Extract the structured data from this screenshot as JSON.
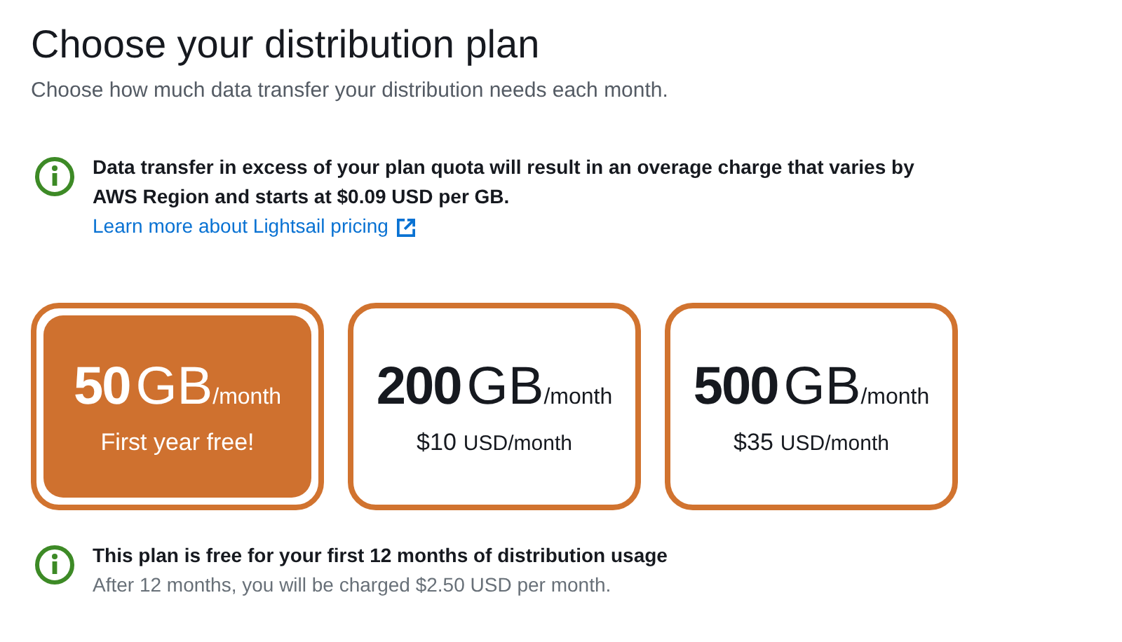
{
  "heading": "Choose your distribution plan",
  "description": "Choose how much data transfer your distribution needs each month.",
  "notice": {
    "text": "Data transfer in excess of your plan quota will result in an overage charge that varies by AWS Region and starts at $0.09 USD per GB.",
    "link": "Learn more about Lightsail pricing"
  },
  "plans": [
    {
      "amount": "50",
      "unit": "GB",
      "period": "/month",
      "price": "First year free!",
      "selected": true
    },
    {
      "amount": "200",
      "unit": "GB",
      "period": "/month",
      "price": "$10",
      "currency": "USD/month",
      "selected": false
    },
    {
      "amount": "500",
      "unit": "GB",
      "period": "/month",
      "price": "$35",
      "currency": "USD/month",
      "selected": false
    }
  ],
  "plan_notice": {
    "title": "This plan is free for your first 12 months of distribution usage",
    "text": "After 12 months, you will be charged $2.50 USD per month."
  }
}
